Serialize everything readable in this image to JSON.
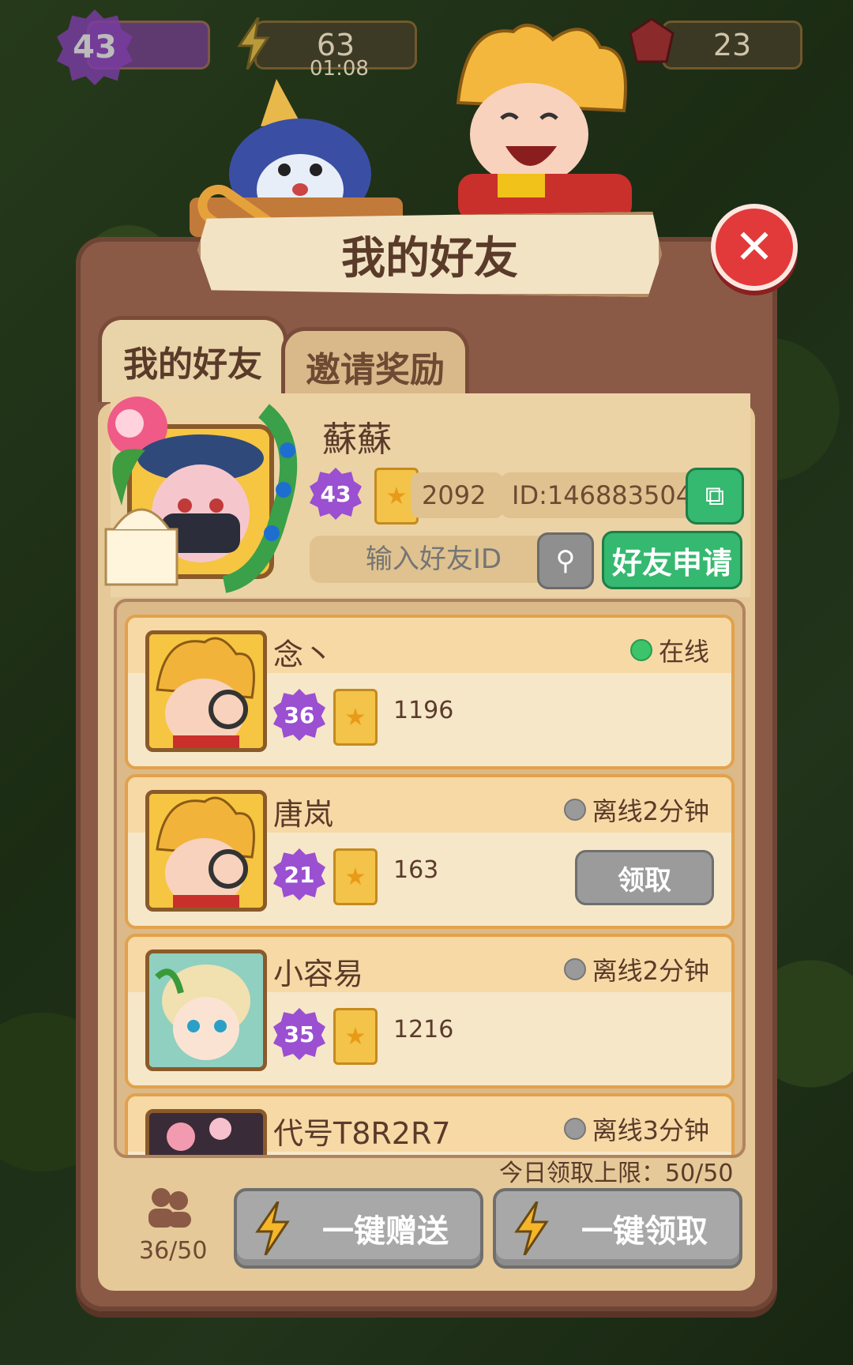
{
  "topbar": {
    "level": "43",
    "energy": "63",
    "energy_timer": "01:08",
    "gems": "23"
  },
  "dialog": {
    "title": "我的好友",
    "tabs": [
      "我的好友",
      "邀请奖励"
    ],
    "active_tab": 0
  },
  "profile": {
    "name": "蘇蘇",
    "level": "43",
    "stars": "2092",
    "id": "ID:146883504",
    "search_placeholder": "输入好友ID",
    "apply_label": "好友申请"
  },
  "friends": [
    {
      "name": "念丶",
      "level": "36",
      "stars": "1196",
      "status": "在线",
      "online": true
    },
    {
      "name": "唐岚",
      "level": "21",
      "stars": "163",
      "status": "离线2分钟",
      "online": false,
      "claim_label": "领取"
    },
    {
      "name": "小容易",
      "level": "35",
      "stars": "1216",
      "status": "离线2分钟",
      "online": false
    },
    {
      "name": "代号T8R2R7",
      "status": "离线3分钟",
      "online": false
    }
  ],
  "footer": {
    "daily_limit": "今日领取上限：50/50",
    "friend_count": "36/50",
    "send_all": "一键赠送",
    "claim_all": "一键领取"
  },
  "colors": {
    "panel": "#8a5a47",
    "inner": "#e6c998",
    "green": "#35b86f",
    "close": "#e23a3a",
    "level_badge": "#9b4fd1",
    "online_dot": "#3cc46a",
    "offline_dot": "#9a9a9a"
  }
}
